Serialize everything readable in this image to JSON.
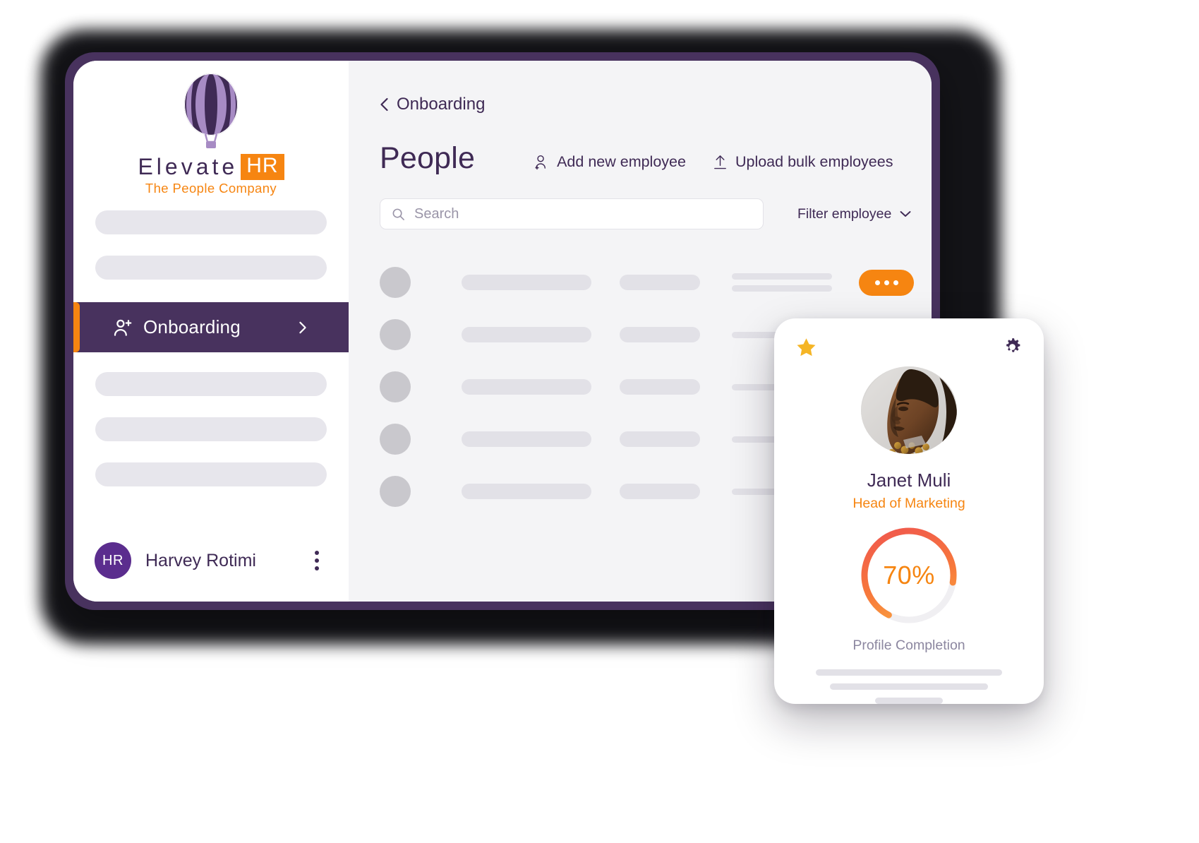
{
  "brand": {
    "name_primary": "Elevate",
    "name_badge": "HR",
    "tagline": "The People Company",
    "logo_icon": "hot-air-balloon-icon",
    "purple": "#48325e",
    "light_purple": "#a78bc4",
    "orange": "#f68511"
  },
  "sidebar": {
    "active_item": {
      "label": "Onboarding",
      "icon": "user-plus-icon",
      "chevron": "chevron-right-icon"
    },
    "placeholder_items_above": 2,
    "placeholder_items_below": 3,
    "footer": {
      "avatar_initials": "HR",
      "user_name": "Harvey Rotimi",
      "menu_icon": "kebab-menu-icon"
    }
  },
  "main": {
    "breadcrumb": {
      "back_icon": "chevron-left-icon",
      "label": "Onboarding"
    },
    "page_title": "People",
    "actions": [
      {
        "label": "Add new employee",
        "icon": "user-add-icon"
      },
      {
        "label": "Upload bulk employees",
        "icon": "upload-icon"
      }
    ],
    "search": {
      "placeholder": "Search",
      "value": "",
      "icon": "search-icon"
    },
    "filter": {
      "label": "Filter employee",
      "icon": "chevron-down-icon"
    },
    "rows": [
      {
        "has_action": true,
        "action_icon": "ellipsis-icon"
      },
      {
        "has_action": false,
        "action_icon": ""
      },
      {
        "has_action": false,
        "action_icon": ""
      },
      {
        "has_action": false,
        "action_icon": ""
      },
      {
        "has_action": false,
        "action_icon": ""
      }
    ]
  },
  "profile_card": {
    "favorite_icon": "star-icon",
    "settings_icon": "gear-icon",
    "photo": "employee-portrait",
    "name": "Janet Muli",
    "role": "Head of Marketing",
    "progress_value": "70%",
    "progress_percent": 70,
    "progress_caption": "Profile Completion",
    "ring_gradient_from": "#ef5350",
    "ring_gradient_to": "#fbaa3c",
    "ring_track": "#f0eff2"
  }
}
